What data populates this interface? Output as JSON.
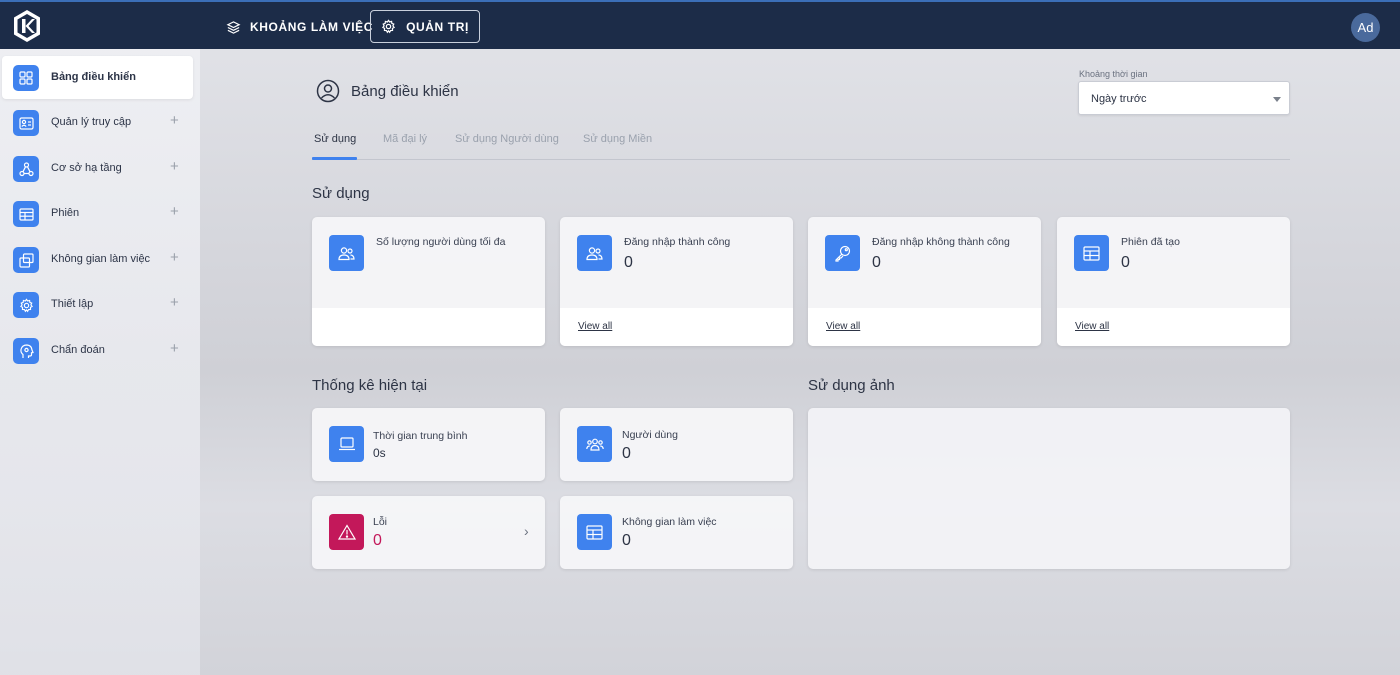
{
  "topbar": {
    "workspace_label": "KHOẢNG LÀM VIỆC",
    "admin_label": "QUẢN TRỊ",
    "avatar_initials": "Ad",
    "bar_color": "#1c2c48"
  },
  "sidebar": {
    "items": [
      {
        "label": "Bảng điều khiển",
        "icon": "dashboard-grid-icon",
        "active": true
      },
      {
        "label": "Quản lý truy cập",
        "icon": "id-card-icon",
        "expandable": true
      },
      {
        "label": "Cơ sở hạ tầng",
        "icon": "network-nodes-icon",
        "expandable": true
      },
      {
        "label": "Phiên",
        "icon": "table-icon",
        "expandable": true
      },
      {
        "label": "Không gian làm việc",
        "icon": "windows-icon",
        "expandable": true
      },
      {
        "label": "Thiết lập",
        "icon": "gear-icon",
        "expandable": true
      },
      {
        "label": "Chẩn đoán",
        "icon": "head-diagnostic-icon",
        "expandable": true
      }
    ],
    "accent": "#3f82ee"
  },
  "main": {
    "page_title": "Bảng điều khiển",
    "time_range": {
      "label": "Khoảng thời gian",
      "selected": "Ngày trước"
    },
    "tabs": [
      {
        "label": "Sử dụng",
        "active": true
      },
      {
        "label": "Mã đại lý"
      },
      {
        "label": "Sử dụng Người dùng"
      },
      {
        "label": "Sử dụng Miền"
      }
    ],
    "usage": {
      "title": "Sử dụng",
      "cards": [
        {
          "label": "Số lượng người dùng tối đa",
          "value": "",
          "link": "",
          "icon": "users-icon"
        },
        {
          "label": "Đăng nhập thành công",
          "value": "0",
          "link": "View all",
          "icon": "users-icon"
        },
        {
          "label": "Đăng nhập không thành công",
          "value": "0",
          "link": "View all",
          "icon": "key-icon"
        },
        {
          "label": "Phiên đã tạo",
          "value": "0",
          "link": "View all",
          "icon": "table-icon"
        }
      ]
    },
    "current_stats": {
      "title": "Thống kê hiện tại",
      "cards": [
        {
          "label": "Thời gian trung bình",
          "value": "0s",
          "icon": "laptop-icon"
        },
        {
          "label": "Người dùng",
          "value": "0",
          "icon": "user-group-icon"
        },
        {
          "label": "Lỗi",
          "value": "0",
          "icon": "warning-triangle-icon",
          "color": "#c3185a"
        },
        {
          "label": "Không gian làm việc",
          "value": "0",
          "icon": "table-icon"
        }
      ]
    },
    "image_usage": {
      "title": "Sử dụng ảnh"
    }
  }
}
